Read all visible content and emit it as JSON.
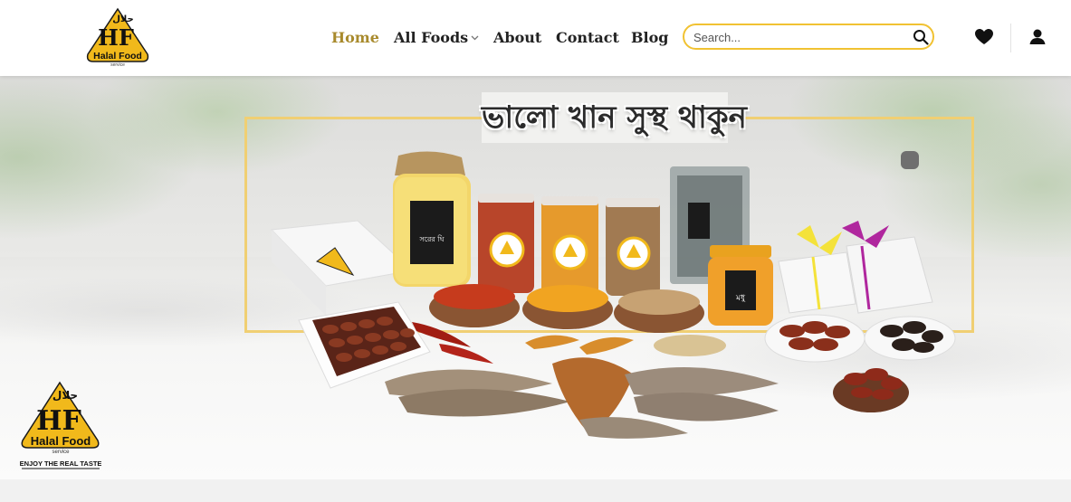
{
  "brand": {
    "logo_arabic": "حلال",
    "logo_mark": "HF",
    "logo_name": "Halal Food",
    "logo_sub": "service",
    "tagline_slogan": "ENJOY THE REAL TASTE"
  },
  "nav": {
    "items": [
      {
        "label": "Home",
        "active": true
      },
      {
        "label": "All Foods",
        "has_dropdown": true
      },
      {
        "label": "About"
      },
      {
        "label": "Contact"
      },
      {
        "label": "Blog"
      }
    ]
  },
  "search": {
    "placeholder": "Search...",
    "value": ""
  },
  "icons": {
    "search": "search-icon",
    "wishlist": "heart-icon",
    "account": "user-icon",
    "dropdown": "chevron-down-icon"
  },
  "hero": {
    "headline": "ভালো খান সুস্থ থাকুন",
    "product_labels": {
      "ghee_jar": "সরের ঘি",
      "honey_jar": "মধু"
    }
  },
  "colors": {
    "accent": "#f1c232",
    "active_nav": "#a88a2c",
    "frame": "#f0cf73",
    "text": "#222222"
  }
}
